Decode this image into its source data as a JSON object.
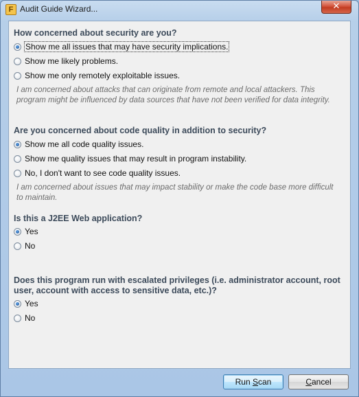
{
  "window": {
    "title": "Audit Guide Wizard...",
    "app_icon_letter": "F",
    "close_glyph": "✕"
  },
  "sections": [
    {
      "question": "How concerned about security are you?",
      "options": [
        {
          "label": "Show me all issues that may have security implications.",
          "checked": true,
          "focused": true
        },
        {
          "label": "Show me likely problems.",
          "checked": false
        },
        {
          "label": "Show me only remotely exploitable issues.",
          "checked": false
        }
      ],
      "note": "I am concerned about attacks that can originate from remote and local attackers. This program might be influenced by data sources that have not been verified for data integrity."
    },
    {
      "question": "Are you concerned about code quality in addition to security?",
      "options": [
        {
          "label": "Show me all code quality issues.",
          "checked": true
        },
        {
          "label": "Show me quality issues that may result in program instability.",
          "checked": false
        },
        {
          "label": "No, I don't want to see code quality issues.",
          "checked": false
        }
      ],
      "note": "I am concerned about issues that may impact stability or make the code base more difficult to maintain."
    },
    {
      "question": "Is this a J2EE Web application?",
      "options": [
        {
          "label": "Yes",
          "checked": true
        },
        {
          "label": "No",
          "checked": false
        }
      ]
    },
    {
      "question": "Does this program run with escalated privileges (i.e. administrator account, root user, account with access to sensitive data, etc.)?",
      "options": [
        {
          "label": "Yes",
          "checked": true
        },
        {
          "label": "No",
          "checked": false
        }
      ]
    }
  ],
  "buttons": {
    "run_scan": {
      "before": "Run ",
      "underlined": "S",
      "after": "can"
    },
    "cancel": {
      "before": "",
      "underlined": "C",
      "after": "ancel"
    }
  }
}
